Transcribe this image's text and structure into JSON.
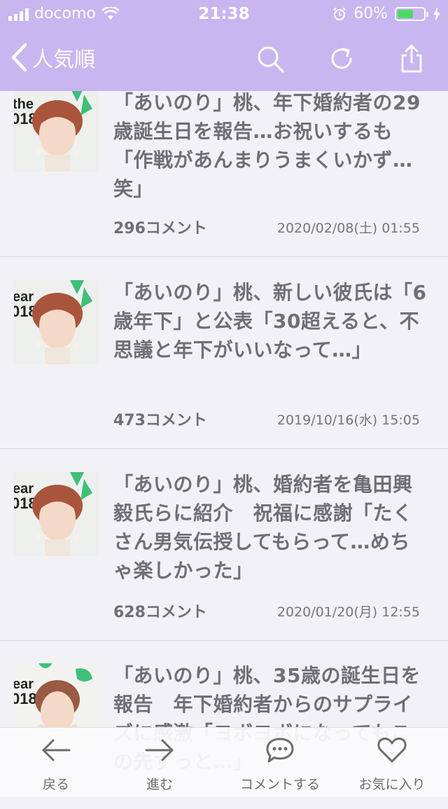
{
  "status_bar": {
    "carrier": "docomo",
    "time": "21:38",
    "battery": "60%",
    "battery_level": 0.6
  },
  "nav": {
    "back_label": "人気順",
    "icons": [
      "search-icon",
      "refresh-icon",
      "share-icon"
    ]
  },
  "articles": [
    {
      "title": "「あいのり」桃、年下婚約者の29歳誕生日を報告…お祝いするも「作戦があんまりうまくいかず…笑」",
      "comments": "296コメント",
      "date": "2020/02/08(土) 01:55"
    },
    {
      "title": "「あいのり」桃、新しい彼氏は「6歳年下」と公表「30超えると、不思議と年下がいいなって…」",
      "comments": "473コメント",
      "date": "2019/10/16(水) 15:05"
    },
    {
      "title": "「あいのり」桃、婚約者を亀田興毅氏らに紹介　祝福に感謝「たくさん男気伝授してもらって…めちゃ楽しかった」",
      "comments": "628コメント",
      "date": "2020/01/20(月) 12:55"
    },
    {
      "title": "「あいのり」桃、35歳の誕生日を報告　年下婚約者からのサプライズに感激「ヨボヨボになってもこの先ずっと…」"
    }
  ],
  "tabs": [
    {
      "label": "戻る",
      "icon": "arrow-left-icon"
    },
    {
      "label": "進む",
      "icon": "arrow-right-icon"
    },
    {
      "label": "コメントする",
      "icon": "comment-icon"
    },
    {
      "label": "お気に入り",
      "icon": "heart-icon"
    }
  ],
  "colors": {
    "header": "#c7b6f0",
    "background": "#f2f1f6",
    "text": "#6f6f74",
    "battery_fill": "#4cd964"
  }
}
